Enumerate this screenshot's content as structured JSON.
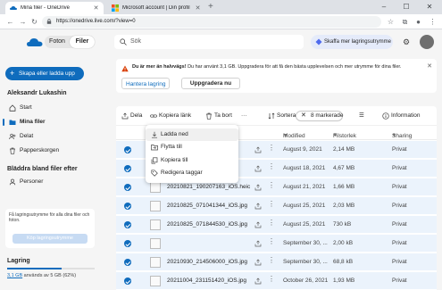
{
  "browser": {
    "tabs": [
      {
        "title": "Mina filer - OneDrive",
        "active": true,
        "icon": "onedrive-favicon"
      },
      {
        "title": "Microsoft account | Din profil",
        "active": false,
        "icon": "microsoft-favicon"
      }
    ],
    "new_tab": "+",
    "window_controls": {
      "minimize": "–",
      "maximize": "☐",
      "close": "✕"
    },
    "url": "https://onedrive.live.com/?view=0",
    "nav": {
      "back": "←",
      "forward": "→",
      "reload": "↻"
    }
  },
  "header": {
    "toggle": {
      "photos": "Foton",
      "files": "Filer"
    },
    "search_placeholder": "Sök",
    "premium": "Skaffa mer lagringsutrymme",
    "accent": "#0f6cbd"
  },
  "sidebar": {
    "create_button": "Skapa eller ladda upp",
    "user": "Aleksandr Lukashin",
    "nav": [
      {
        "label": "Start",
        "icon": "home-icon"
      },
      {
        "label": "Mina filer",
        "icon": "folder-icon",
        "selected": true
      },
      {
        "label": "Delat",
        "icon": "people-icon"
      },
      {
        "label": "Papperskorgen",
        "icon": "trash-icon"
      }
    ],
    "browse_heading": "Bläddra bland filer efter",
    "browse_items": [
      {
        "label": "Personer",
        "icon": "person-icon"
      }
    ],
    "storage_card_text": "Få lagringsutrymme för alla dina filer och foton.",
    "storage_card_button": "Köp lagringsutrymme",
    "storage_heading": "Lagring",
    "usage_used": "3,1 GB",
    "usage_rest": "används av 5 GB (62%)",
    "usage_fraction": 0.62
  },
  "banner": {
    "title": "Du är mer än halvvägs!",
    "text": "Du har använt 3,1 GB. Uppgradera för att få den bästa upplevelsen och mer utrymme för dina filer.",
    "manage_link": "Hantera lagring",
    "upgrade_button": "Uppgradera nu",
    "close": "✕"
  },
  "commands": {
    "share": "Dela",
    "copy_link": "Kopiera länk",
    "delete": "Ta bort",
    "more": "···",
    "sort": "Sortera",
    "selected": "8 markerade",
    "view": "☰",
    "info": "Information"
  },
  "columns": {
    "modified": "Modified",
    "size": "Filstorlek",
    "sharing": "Sharing"
  },
  "rows": [
    {
      "name": "",
      "modified": "August 9, 2021",
      "size": "2,14 MB",
      "access": "Privat",
      "video": false
    },
    {
      "name": "",
      "modified": "August 18, 2021",
      "size": "4,67 MB",
      "access": "Privat",
      "video": true
    },
    {
      "name": "20210821_190207163_iOS.heic",
      "modified": "August 21, 2021",
      "size": "1,66 MB",
      "access": "Privat",
      "video": false
    },
    {
      "name": "20210825_071041344_iOS.jpg",
      "modified": "August 25, 2021",
      "size": "2,03 MB",
      "access": "Privat",
      "video": false
    },
    {
      "name": "20210825_071844530_iOS.jpg",
      "modified": "August 25, 2021",
      "size": "730 kB",
      "access": "Privat",
      "video": false
    },
    {
      "name": "",
      "modified": "September 30, ...",
      "size": "2,00 kB",
      "access": "Privat",
      "video": false
    },
    {
      "name": "20210930_214506000_iOS.jpg",
      "modified": "September 30, ...",
      "size": "68,8 kB",
      "access": "Privat",
      "video": false
    },
    {
      "name": "20211004_231151420_iOS.jpg",
      "modified": "October 26, 2021",
      "size": "1,93 MB",
      "access": "Privat",
      "video": false
    }
  ],
  "context_menu": [
    {
      "label": "Ladda ned",
      "icon": "download-icon"
    },
    {
      "label": "Flytta till",
      "icon": "move-icon"
    },
    {
      "label": "Kopiera till",
      "icon": "copy-icon"
    },
    {
      "label": "Redigera taggar",
      "icon": "tag-icon"
    }
  ]
}
